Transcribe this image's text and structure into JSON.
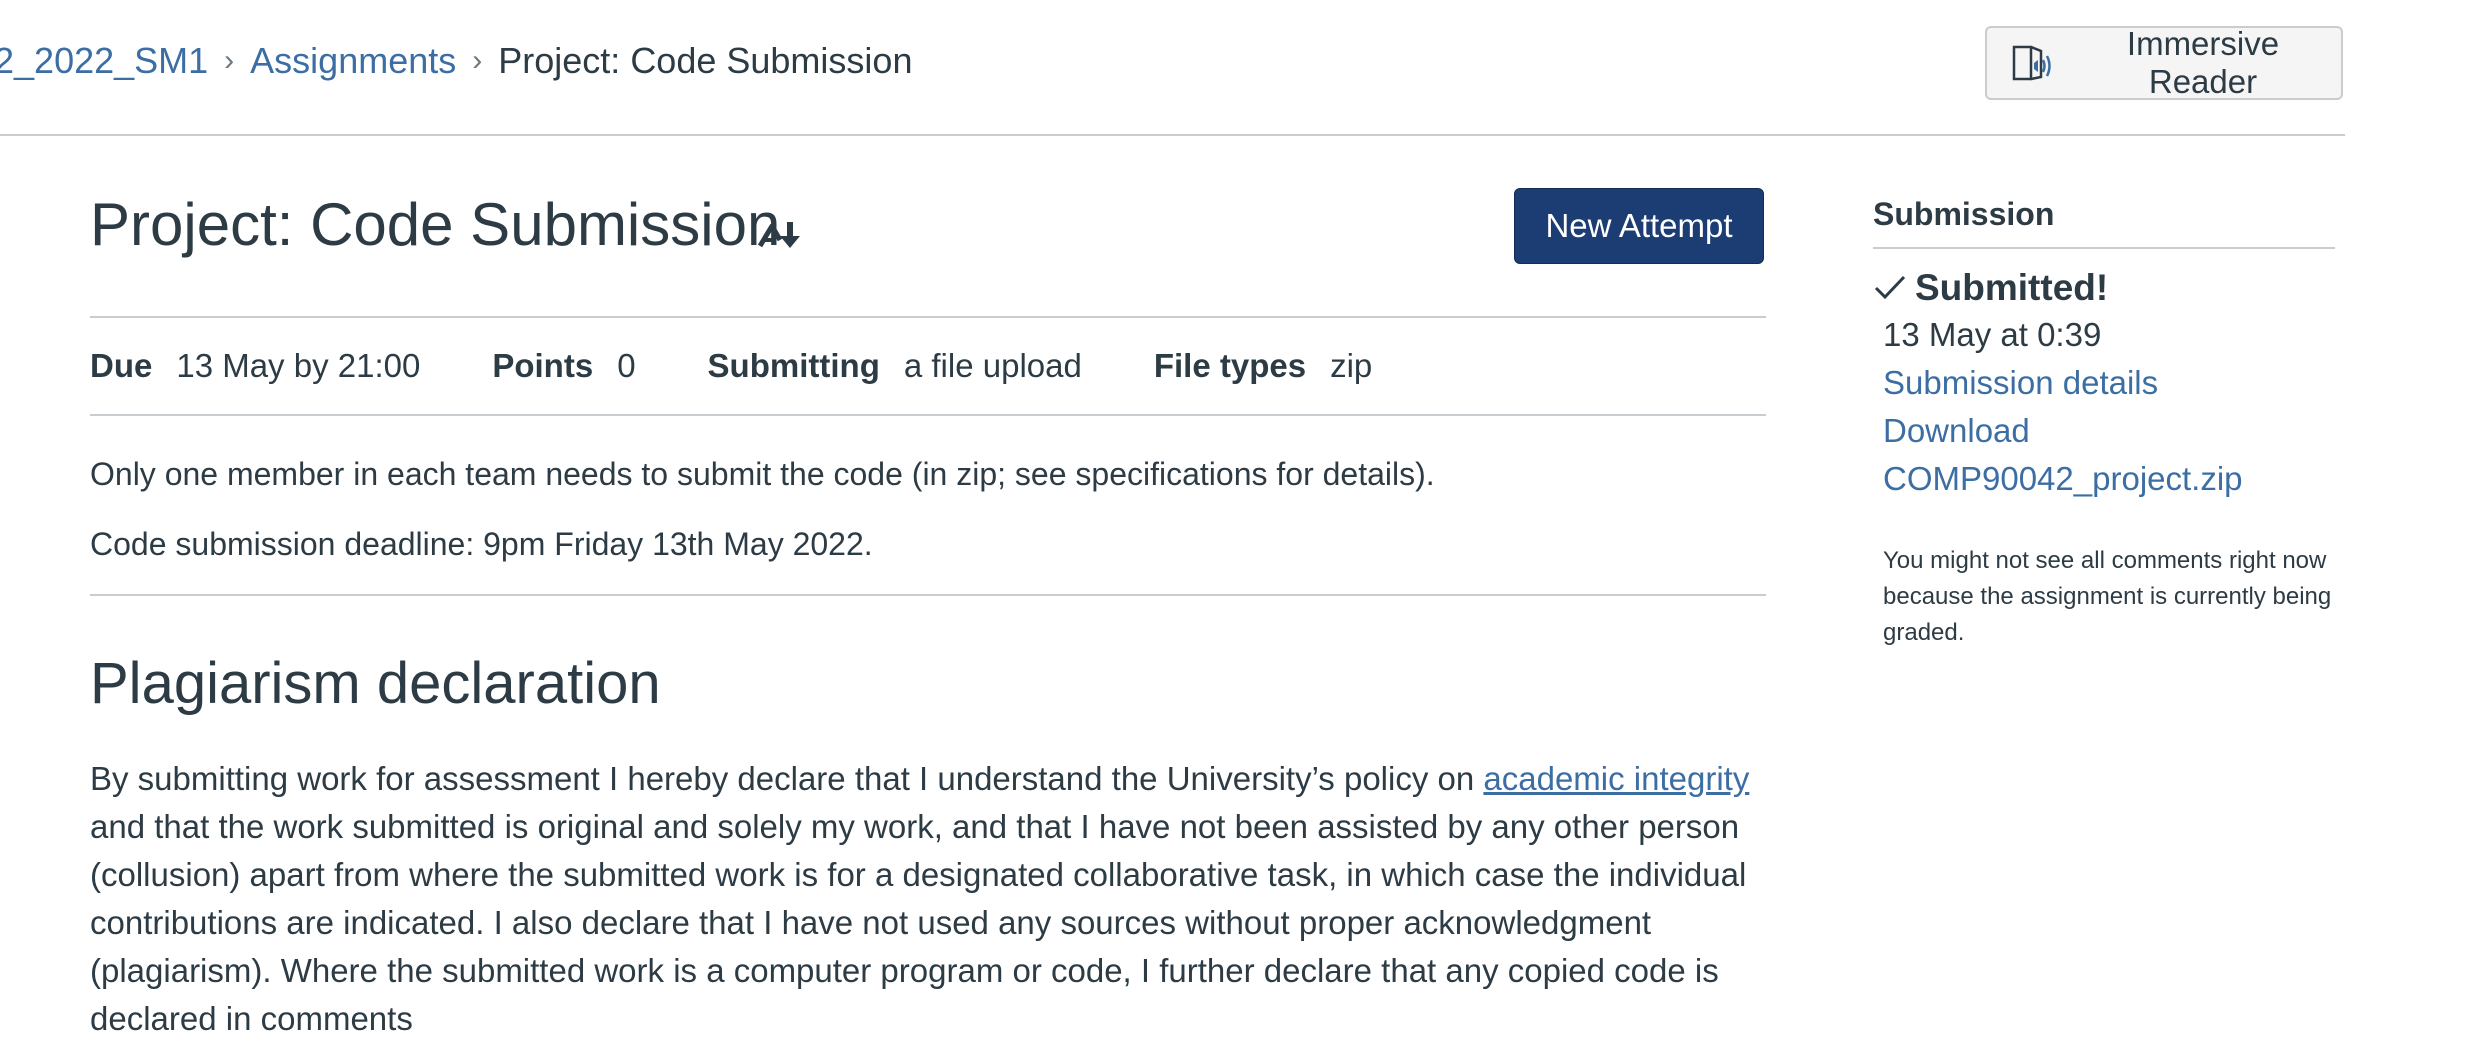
{
  "breadcrumb": {
    "course": "2_2022_SM1",
    "section": "Assignments",
    "current": "Project: Code Submission"
  },
  "immersive_reader": {
    "label": "Immersive Reader",
    "icon": "immersive-reader-icon"
  },
  "assignment": {
    "title": "Project: Code Submission",
    "new_attempt_label": "New Attempt",
    "details": {
      "due_label": "Due",
      "due_value": "13 May by 21:00",
      "points_label": "Points",
      "points_value": "0",
      "submitting_label": "Submitting",
      "submitting_value": "a file upload",
      "file_types_label": "File types",
      "file_types_value": "zip"
    },
    "description": [
      "Only one member in each team needs to submit the code (in zip; see specifications for details).",
      "Code submission deadline: 9pm Friday 13th May 2022."
    ],
    "plagiarism": {
      "heading": "Plagiarism declaration",
      "text_before_link": "By submitting work for assessment I hereby declare that I understand the University’s policy on ",
      "link_text": "academic integrity",
      "text_after_link": " and that the work submitted is original and solely my work, and that I have not been assisted by any other person (collusion) apart from where the submitted work is for a designated collaborative task, in which case the individual contributions are indicated. I also declare that I have not used any sources without proper acknowledgment (plagiarism). Where the submitted work is a computer program or code, I further declare that any copied code is declared in comments"
    }
  },
  "submission": {
    "heading": "Submission",
    "status": "Submitted!",
    "date": "13 May at 0:39",
    "details_link": "Submission details",
    "download_label": "Download",
    "file_name": "COMP90042_project.zip",
    "note": "You might not see all comments right now because the assignment is currently being graded."
  },
  "colors": {
    "link": "#3c6ea4",
    "primary_button": "#1c3d74",
    "text": "#2d3b45",
    "divider": "#c7cdd1"
  }
}
